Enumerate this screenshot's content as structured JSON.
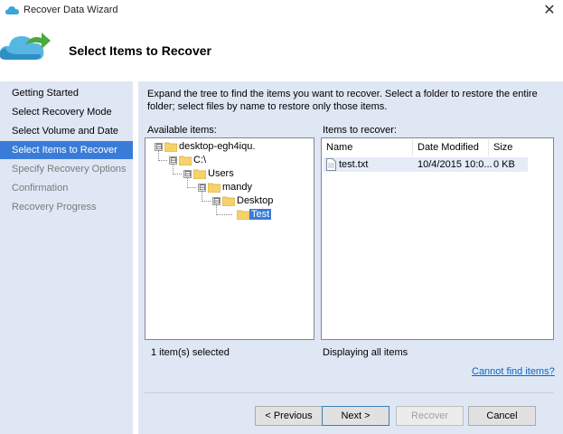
{
  "window": {
    "title": "Recover Data Wizard",
    "close_glyph": "✕",
    "icon": "cloud-app-icon"
  },
  "header": {
    "title": "Select Items to Recover",
    "icon": "cloud-recover-icon"
  },
  "nav": {
    "items": [
      {
        "label": "Getting Started",
        "state": "done"
      },
      {
        "label": "Select Recovery Mode",
        "state": "done"
      },
      {
        "label": "Select Volume and Date",
        "state": "done"
      },
      {
        "label": "Select Items to Recover",
        "state": "active"
      },
      {
        "label": "Specify Recovery Options",
        "state": "pending"
      },
      {
        "label": "Confirmation",
        "state": "pending"
      },
      {
        "label": "Recovery Progress",
        "state": "pending"
      }
    ]
  },
  "main": {
    "instructions": "Expand the tree to find the items you want to recover. Select a folder to restore the entire folder; select files by name to restore only those items.",
    "available_label": "Available items:",
    "recover_label": "Items to recover:",
    "tree": [
      {
        "label": "desktop-egh4iqu.",
        "expander": "⊟"
      },
      {
        "label": "C:\\",
        "expander": "⊟"
      },
      {
        "label": "Users",
        "expander": "⊟"
      },
      {
        "label": "mandy",
        "expander": "⊟"
      },
      {
        "label": "Desktop",
        "expander": "⊟"
      },
      {
        "label": "Test",
        "expander": ""
      }
    ],
    "columns": {
      "name": "Name",
      "date": "Date Modified",
      "size": "Size"
    },
    "files": [
      {
        "name": "test.txt",
        "date": "10/4/2015 10:0...",
        "size": "0 KB"
      }
    ],
    "selected_count": "1 item(s) selected",
    "displaying": "Displaying all items",
    "cannot_find_link": "Cannot find items?"
  },
  "buttons": {
    "previous": "< Previous",
    "next": "Next >",
    "recover": "Recover",
    "cancel": "Cancel"
  },
  "colors": {
    "accent": "#3b7bd8",
    "panel": "#dfe7f4",
    "link": "#0066cc"
  }
}
